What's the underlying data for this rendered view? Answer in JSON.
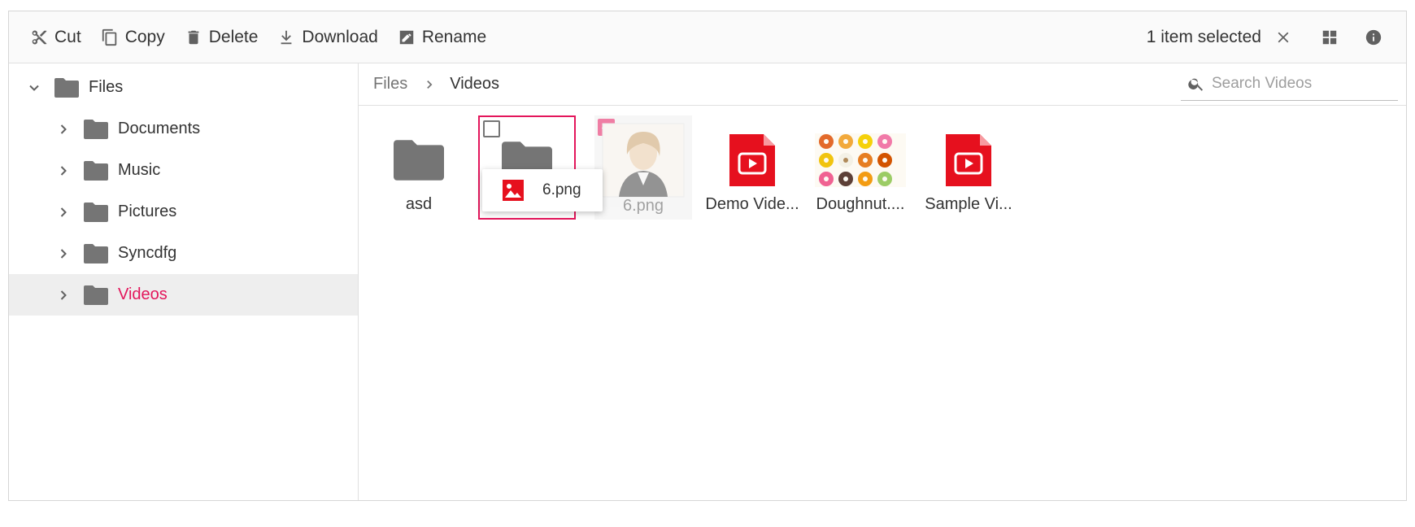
{
  "toolbar": {
    "cut": "Cut",
    "copy": "Copy",
    "delete": "Delete",
    "download": "Download",
    "rename": "Rename",
    "selection_text": "1 item selected"
  },
  "nav": {
    "root": "Files",
    "items": [
      "Documents",
      "Music",
      "Pictures",
      "Syncdfg",
      "Videos"
    ],
    "active": "Videos"
  },
  "breadcrumb": {
    "root": "Files",
    "current": "Videos"
  },
  "search": {
    "placeholder": "Search Videos"
  },
  "files": [
    {
      "name": "asd",
      "type": "folder"
    },
    {
      "name": "",
      "type": "folder"
    },
    {
      "name": "6.png",
      "type": "image-photo"
    },
    {
      "name": "Demo Vide...",
      "type": "video"
    },
    {
      "name": "Doughnut....",
      "type": "image-doughnuts"
    },
    {
      "name": "Sample Vi...",
      "type": "video"
    }
  ],
  "drag": {
    "label": "6.png"
  },
  "colors": {
    "accent": "#e3165b",
    "video_red": "#e6101e",
    "folder_grey": "#757575"
  }
}
